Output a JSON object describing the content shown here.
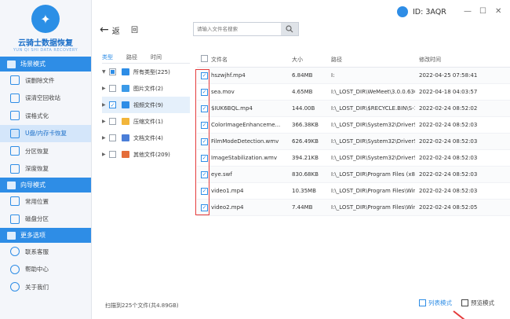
{
  "app": {
    "name": "云骑士数据恢复",
    "subtitle": "YUN QI SHI DATA RECOVERY",
    "user_id": "ID: 3AQR"
  },
  "window": {
    "minimize": "—",
    "maximize": "☐",
    "close": "✕"
  },
  "sidebar": {
    "sections": [
      {
        "title": "场景模式",
        "items": [
          {
            "label": "误删除文件"
          },
          {
            "label": "误清空回收站"
          },
          {
            "label": "误格式化"
          },
          {
            "label": "U盘/内存卡恢复",
            "active": true
          },
          {
            "label": "分区恢复"
          },
          {
            "label": "深度恢复"
          }
        ]
      },
      {
        "title": "向导模式",
        "items": [
          {
            "label": "常用位置"
          },
          {
            "label": "磁盘分区"
          }
        ]
      },
      {
        "title": "更多选项",
        "items": [
          {
            "label": "联系客服"
          },
          {
            "label": "帮助中心"
          },
          {
            "label": "关于我们"
          }
        ]
      }
    ]
  },
  "toolbar": {
    "back_label": "返",
    "back2_label": "回",
    "search_placeholder": "请输入文件名搜索"
  },
  "tree": {
    "tabs": [
      "类型",
      "路径",
      "时间"
    ],
    "rows": [
      {
        "label": "所有类型(225)",
        "color": "#2e8de6"
      },
      {
        "label": "图片文件(2)",
        "color": "#3b9ae8"
      },
      {
        "label": "视频文件(9)",
        "color": "#2e8de6"
      },
      {
        "label": "压缩文件(1)",
        "color": "#f2b53a"
      },
      {
        "label": "文档文件(4)",
        "color": "#4a7ed8"
      },
      {
        "label": "其他文件(209)",
        "color": "#e46d3a"
      }
    ]
  },
  "table": {
    "headers": [
      "文件名",
      "大小",
      "路径",
      "修改时间"
    ],
    "rows": [
      {
        "name": "hszwjhf.mp4",
        "size": "6.84MB",
        "path": "I:",
        "time": "2022-04-25 07:58:41"
      },
      {
        "name": "sea.mov",
        "size": "4.65MB",
        "path": "I:\\_LOST_DIR\\WeMeet\\3.0.0.630\\r...",
        "time": "2022-04-18 04:03:57"
      },
      {
        "name": "$IUK6BQL.mp4",
        "size": "144.00B",
        "path": "I:\\_LOST_DIR\\$RECYCLE.BIN\\S-1-...",
        "time": "2022-02-24 08:52:02"
      },
      {
        "name": "ColorImageEnhanceme...",
        "size": "366.38KB",
        "path": "I:\\_LOST_DIR\\System32\\DriverSto...",
        "time": "2022-02-24 08:52:03"
      },
      {
        "name": "FilmModeDetection.wmv",
        "size": "626.49KB",
        "path": "I:\\_LOST_DIR\\System32\\DriverSto...",
        "time": "2022-02-24 08:52:03"
      },
      {
        "name": "ImageStabilization.wmv",
        "size": "394.21KB",
        "path": "I:\\_LOST_DIR\\System32\\DriverSto...",
        "time": "2022-02-24 08:52:03"
      },
      {
        "name": "eye.swf",
        "size": "830.68KB",
        "path": "I:\\_LOST_DIR\\Program Files (x86)...",
        "time": "2022-02-24 08:52:03"
      },
      {
        "name": "video1.mp4",
        "size": "10.35MB",
        "path": "I:\\_LOST_DIR\\Program Files\\Wind...",
        "time": "2022-02-24 08:52:03"
      },
      {
        "name": "video2.mp4",
        "size": "7.44MB",
        "path": "I:\\_LOST_DIR\\Program Files\\Wind...",
        "time": "2022-02-24 08:52:05"
      }
    ]
  },
  "status": {
    "scan_result": "扫描到225个文件(共4.89GB)"
  },
  "views": {
    "list_label": "列表模式",
    "preview_label": "预览模式"
  }
}
